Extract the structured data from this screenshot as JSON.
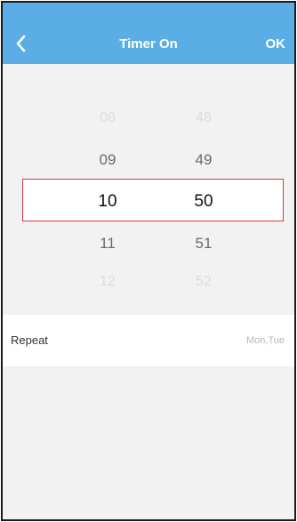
{
  "header": {
    "title": "Timer On",
    "ok_label": "OK",
    "background": "#5aaee5"
  },
  "picker": {
    "hours": [
      "08",
      "09",
      "10",
      "11",
      "12"
    ],
    "minutes": [
      "48",
      "49",
      "50",
      "51",
      "52"
    ],
    "selected_hour": "10",
    "selected_minute": "50",
    "highlight_color": "#d7373f"
  },
  "repeat": {
    "label": "Repeat",
    "value": "Mon,Tue"
  }
}
